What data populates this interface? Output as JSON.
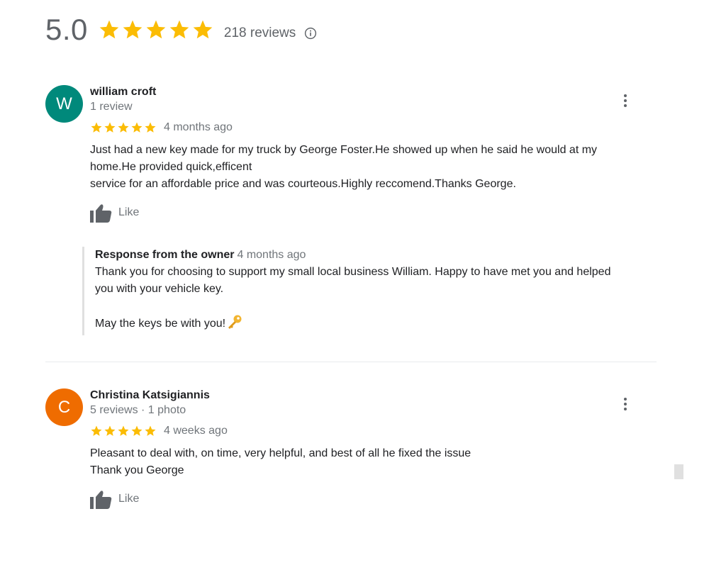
{
  "summary": {
    "score": "5.0",
    "star_rating": 5,
    "reviews_label": "218 reviews",
    "info_icon": "info-icon",
    "star_color": "#fbbc04"
  },
  "reviews": [
    {
      "avatar_letter": "W",
      "avatar_color": "#00897b",
      "name": "william croft",
      "meta": "1 review",
      "rating": 5,
      "when": "4 months ago",
      "text_lines": [
        "Just had a new key made for my truck by George Foster.He showed up when he said he would at my",
        "home.He provided quick,efficent",
        "service for an affordable price and was courteous.Highly reccomend.Thanks George."
      ],
      "like_label": "Like",
      "menu_icon": "more-vert-icon",
      "response": {
        "title": "Response from the owner",
        "when": "4 months ago",
        "lines": [
          "Thank you for choosing to support my small local business William. Happy to have met you and helped",
          "you with your vehicle key."
        ],
        "closing": "May the keys be with you!",
        "emoji_icon": "key-icon"
      }
    },
    {
      "avatar_letter": "C",
      "avatar_color": "#ef6c00",
      "name": "Christina Katsigiannis",
      "meta": "5 reviews · 1 photo",
      "rating": 5,
      "when": "4 weeks ago",
      "text_lines": [
        "Pleasant to deal with, on time, very helpful, and best of all he fixed the issue",
        "Thank you George"
      ],
      "like_label": "Like",
      "menu_icon": "more-vert-icon"
    }
  ]
}
